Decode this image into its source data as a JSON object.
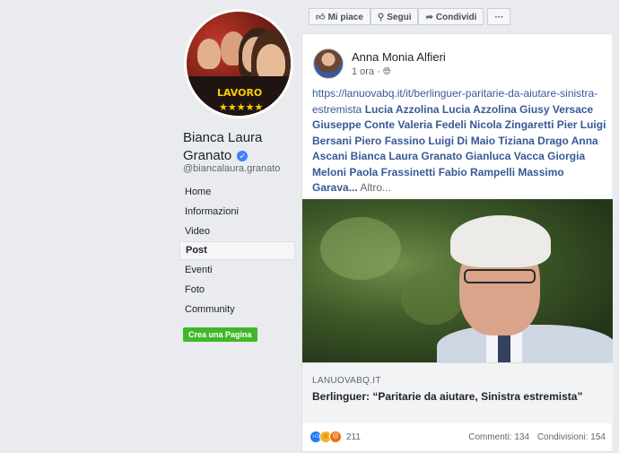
{
  "profile": {
    "name": "Bianca Laura Granato",
    "handle": "@biancalaura.granato",
    "photo_logo": "LAVORO",
    "photo_stars": "★★★★★"
  },
  "nav": {
    "items": [
      "Home",
      "Informazioni",
      "Video",
      "Post",
      "Eventi",
      "Foto",
      "Community"
    ],
    "active": "Post",
    "create_page": "Crea una Pagina"
  },
  "actions": {
    "like": "Mi piace",
    "follow": "Segui",
    "share": "Condividi",
    "more": "···"
  },
  "post": {
    "author": "Anna Monia Alfieri",
    "time": "1 ora",
    "url": "https://lanuovabq.it/it/berlinguer-paritarie-da-aiutare-sinistra-estremista",
    "tags_text": "Lucia Azzolina Lucia Azzolina Giusy Versace Giuseppe Conte Valeria Fedeli Nicola Zingaretti Pier Luigi Bersani Piero Fassino Luigi Di Maio Tiziana Drago Anna Ascani Bianca Laura Granato Gianluca Vacca Giorgia Meloni Paola Frassinetti Fabio Rampelli Massimo Garava...",
    "more": "Altro...",
    "link_domain": "LANUOVABQ.IT",
    "link_title": "Berlinguer: “Paritarie da aiutare, Sinistra estremista”",
    "reactions_count": "211",
    "comments": "Commenti: 134",
    "shares": "Condivisioni: 154"
  },
  "colors": {
    "link": "#385898",
    "accent_button": "#42b72a",
    "background": "#e9ebee"
  },
  "icons": [
    "verified-badge-icon",
    "thumbs-up-icon",
    "rss-icon",
    "share-arrow-icon",
    "globe-icon",
    "like-reaction-icon",
    "haha-reaction-icon",
    "angry-reaction-icon"
  ]
}
